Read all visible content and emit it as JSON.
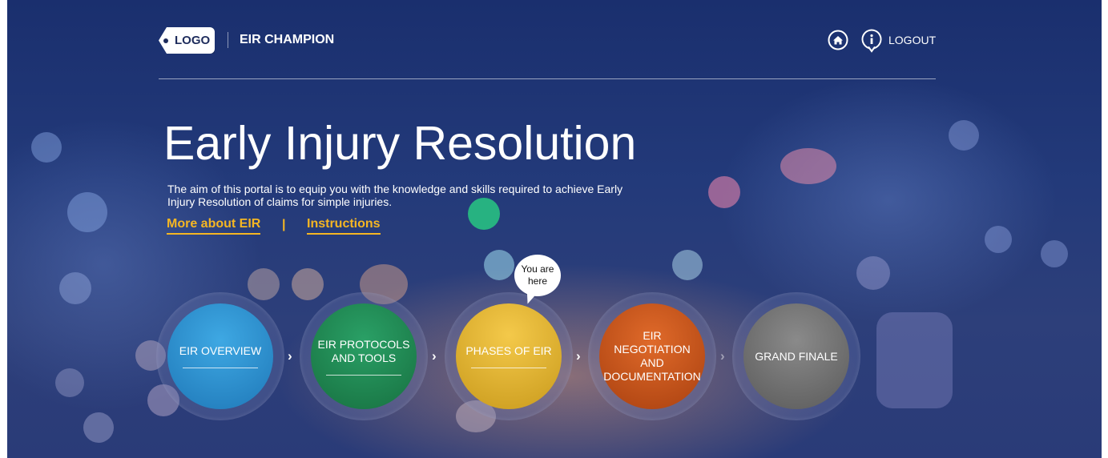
{
  "header": {
    "logo_text": "LOGO",
    "app_title": "EIR CHAMPION",
    "home_icon": "home-icon",
    "info_icon": "info-icon",
    "logout_label": "LOGOUT"
  },
  "hero": {
    "title": "Early Injury Resolution",
    "description": "The aim of this portal is to equip you with the knowledge and skills required to achieve Early Injury Resolution of claims for simple injuries.",
    "link_more": "More about EIR",
    "separator": "|",
    "link_instructions": "Instructions"
  },
  "steps": [
    {
      "label": "EIR OVERVIEW",
      "color": "#2f8fd0"
    },
    {
      "label": "EIR PROTOCOLS AND TOOLS",
      "color": "#1f8a55"
    },
    {
      "label": "PHASES OF EIR",
      "color": "#e3b12c"
    },
    {
      "label": "EIR NEGOTIATION AND DOCUMENTATION",
      "color": "#c9561c"
    },
    {
      "label": "GRAND FINALE",
      "color": "#6a6a6a"
    }
  ],
  "bubble": {
    "line1": "You are",
    "line2": "here"
  },
  "colors": {
    "accent": "#f5b623",
    "background": "#233a7a"
  }
}
